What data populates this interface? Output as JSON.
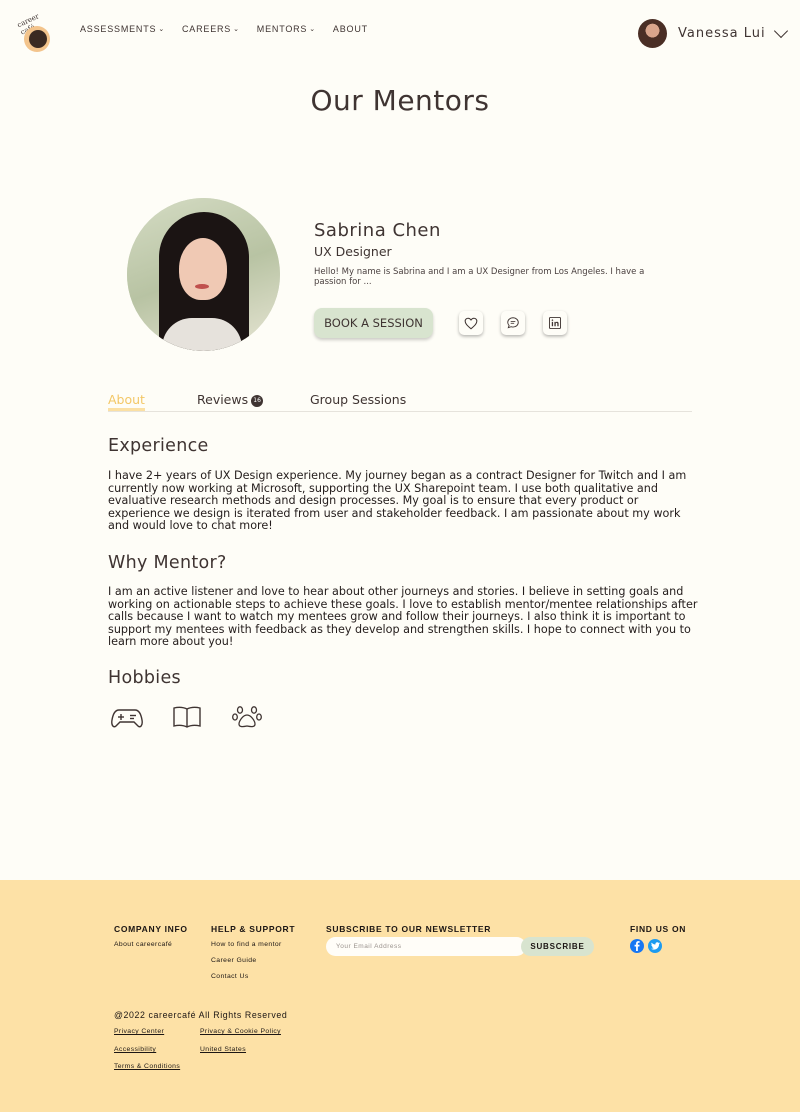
{
  "header": {
    "logo_text": "career café",
    "nav": [
      {
        "label": "ASSESSMENTS",
        "has_dropdown": true
      },
      {
        "label": "CAREERS",
        "has_dropdown": true
      },
      {
        "label": "MENTORS",
        "has_dropdown": true
      },
      {
        "label": "ABOUT",
        "has_dropdown": false
      }
    ],
    "user_name": "Vanessa Lui"
  },
  "page_title": "Our Mentors",
  "mentor": {
    "name": "Sabrina Chen",
    "role": "UX Designer",
    "blurb": "Hello! My name is Sabrina and I am a UX Designer from Los Angeles. I have a passion for ...",
    "book_label": "BOOK A SESSION",
    "actions": [
      "heart-icon",
      "chat-icon",
      "linkedin-icon"
    ]
  },
  "tabs": [
    {
      "label": "About",
      "active": true
    },
    {
      "label": "Reviews",
      "badge": "16",
      "active": false
    },
    {
      "label": "Group Sessions",
      "active": false
    }
  ],
  "sections": {
    "experience_title": "Experience",
    "experience_body": "I have 2+ years of UX Design experience. My journey began as a contract Designer for Twitch and I am currently now working at Microsoft, supporting the UX Sharepoint team. I use both qualitative and evaluative research methods and design processes. My goal is to ensure that every product or experience we design is iterated from user and stakeholder feedback. I am passionate about my work and would love to chat more!",
    "why_title": "Why Mentor?",
    "why_body": "I am an active listener and love to hear about other journeys and stories. I believe in setting goals and working on actionable steps to achieve these goals. I love to establish mentor/mentee relationships after calls because I want to watch my mentees grow and follow their journeys. I also think it is important to support my mentees with feedback as they develop and strengthen skills. I hope to connect with you to learn more about you!",
    "hobbies_title": "Hobbies",
    "hobbies": [
      "gamepad-icon",
      "book-icon",
      "paw-icon"
    ]
  },
  "footer": {
    "company_head": "COMPANY INFO",
    "company_links": [
      "About careercafé"
    ],
    "help_head": "HELP & SUPPORT",
    "help_links": [
      "How to find a mentor",
      "Career Guide",
      "Contact Us"
    ],
    "newsletter_head": "SUBSCRIBE TO OUR NEWSLETTER",
    "email_placeholder": "Your Email Address",
    "subscribe_label": "SUBSCRIBE",
    "find_head": "FIND US ON",
    "social": [
      "facebook-icon",
      "twitter-icon"
    ],
    "copyright": "@2022 careercafé All Rights Reserved",
    "legal_left": [
      "Privacy Center",
      "Accessibility",
      "Terms & Conditions"
    ],
    "legal_right": [
      "Privacy & Cookie Policy",
      "United States"
    ]
  },
  "colors": {
    "background": "#fefdf7",
    "footer": "#fde1a6",
    "accent_green": "#d8e4cf",
    "active_tab": "#f3c766",
    "text": "#3f3432"
  }
}
